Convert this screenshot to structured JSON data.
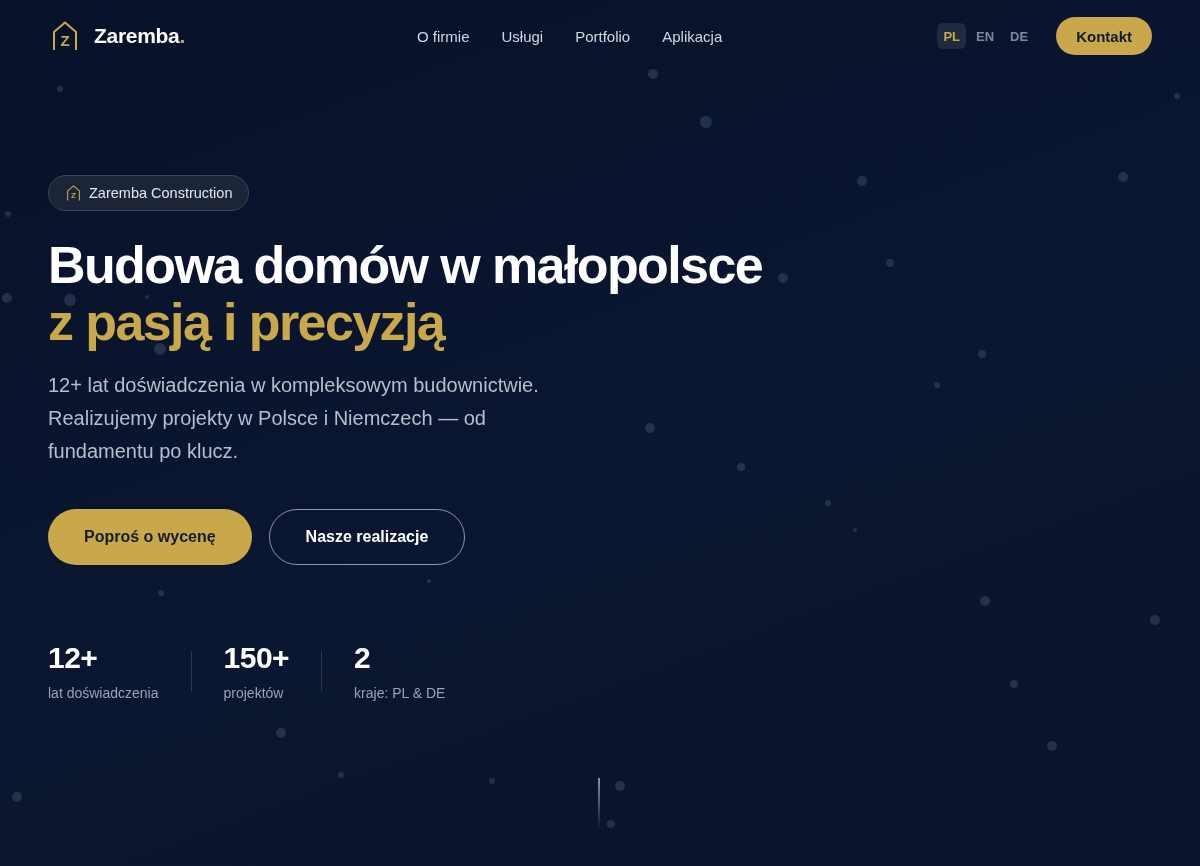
{
  "header": {
    "logo": {
      "mark": "Z",
      "name": "Zaremba",
      "accent": "."
    },
    "nav": [
      "O firmie",
      "Usługi",
      "Portfolio",
      "Aplikacja"
    ],
    "languages": [
      {
        "label": "PL",
        "selected": true
      },
      {
        "label": "EN",
        "selected": false
      },
      {
        "label": "DE",
        "selected": false
      }
    ],
    "contact_button": "Kontakt"
  },
  "hero": {
    "badge": {
      "mark": "Z",
      "label": "Zaremba Construction"
    },
    "heading": "Budowa domów w małopolsce",
    "heading_highlight": "z pasją i precyzją",
    "description": "12+ lat doświadczenia w kompleksowym budownictwie. Realizujemy projekty w Polsce i Niemczech — od fundamentu po klucz.",
    "buttons": [
      {
        "label": "Poproś o wycenę",
        "kind": "primary"
      },
      {
        "label": "Nasze realizacje",
        "kind": "outline"
      }
    ],
    "stats": [
      {
        "value": "12+",
        "label": "lat doświadczenia"
      },
      {
        "value": "150+",
        "label": "projektów"
      },
      {
        "value": "2",
        "label": "kraje: PL & DE"
      }
    ]
  }
}
